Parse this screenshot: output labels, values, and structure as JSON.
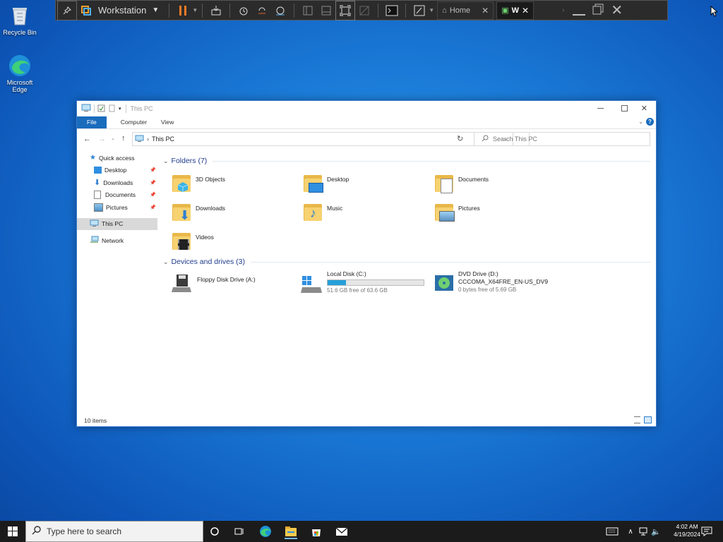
{
  "desktop": {
    "icons": [
      {
        "label": "Recycle Bin"
      },
      {
        "label": "Microsoft Edge"
      }
    ]
  },
  "vmware": {
    "title": "Workstation",
    "tabs": [
      {
        "label": "Home"
      },
      {
        "label": "W"
      }
    ]
  },
  "explorer": {
    "title": "This PC",
    "ribbon_tabs": [
      "File",
      "Computer",
      "View"
    ],
    "address": "This PC",
    "search_placeholder": "Search This PC",
    "nav": {
      "quick_access": "Quick access",
      "pinned": [
        "Desktop",
        "Downloads",
        "Documents",
        "Pictures"
      ],
      "this_pc": "This PC",
      "network": "Network"
    },
    "folders_header": "Folders (7)",
    "folders": [
      "3D Objects",
      "Desktop",
      "Documents",
      "Downloads",
      "Music",
      "Pictures",
      "Videos"
    ],
    "devices_header": "Devices and drives (3)",
    "drives": [
      {
        "name": "Floppy Disk Drive (A:)"
      },
      {
        "name": "Local Disk (C:)",
        "free": "51.6 GB free of 63.6 GB",
        "used_fraction": 0.189
      },
      {
        "name": "DVD Drive (D:)",
        "label": "CCCOMA_X64FRE_EN-US_DV9",
        "free": "0 bytes free of 5.69 GB"
      }
    ],
    "status": "10 items"
  },
  "taskbar": {
    "search_placeholder": "Type here to search",
    "time": "4:02 AM",
    "date": "4/19/2024"
  },
  "colors": {
    "accent": "#1a6cbd",
    "drive_bar": "#26a0da",
    "folder": "#f7d271"
  }
}
